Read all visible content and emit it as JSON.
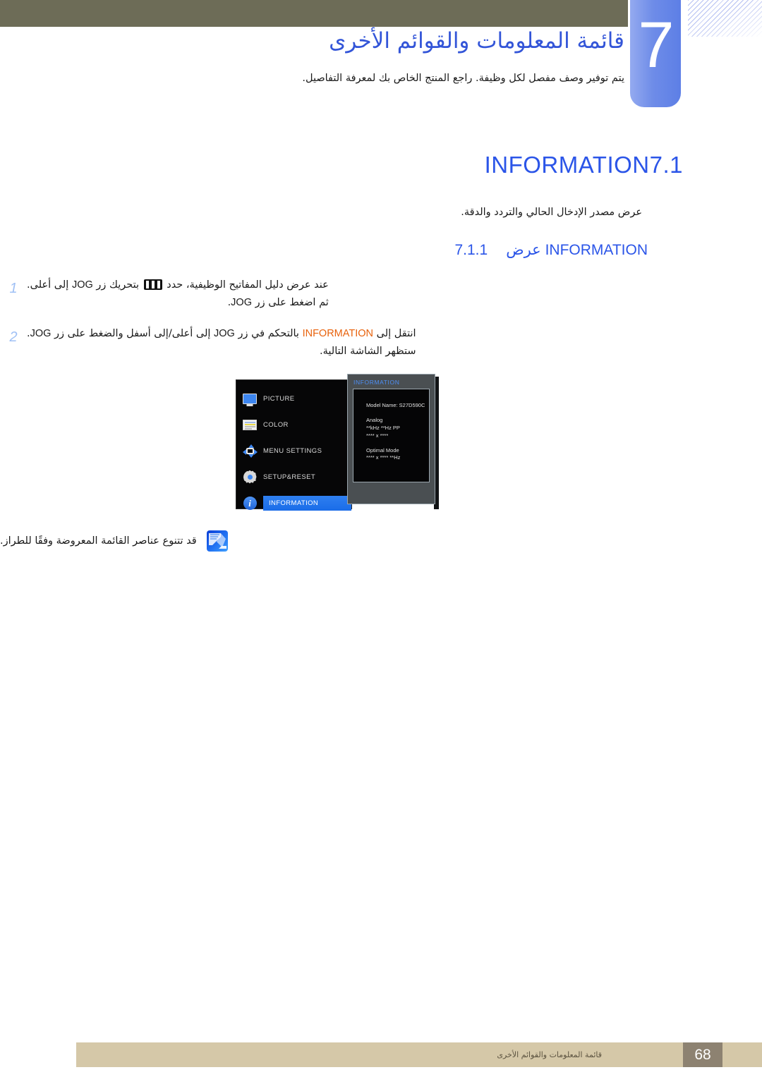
{
  "chapter": {
    "number": "7",
    "title": "قائمة المعلومات والقوائم الأخرى",
    "subtitle": "يتم توفير وصف مفصل لكل وظيفة. راجع المنتج الخاص بك لمعرفة التفاصيل."
  },
  "section": {
    "number": "7.1",
    "title": "INFORMATION",
    "description": "عرض مصدر الإدخال الحالي والتردد والدقة.",
    "sub_number": "7.1.1",
    "sub_title_ar": "عرض",
    "sub_title_en": "INFORMATION"
  },
  "steps": [
    {
      "number": "1",
      "text_before": "عند عرض دليل المفاتيح الوظيفية، حدد",
      "icon": "menu-bars-icon",
      "text_mid": "بتحريك زر",
      "key": "JOG",
      "text_after": "إلى أعلى.",
      "line2_before": "ثم اضغط على زر",
      "line2_key": "JOG",
      "line2_after": "."
    },
    {
      "number": "2",
      "text_before": "انتقل إلى",
      "highlight": "INFORMATION",
      "text_mid": "بالتحكم في زر",
      "key": "JOG",
      "text_after": "إلى أعلى/إلى أسفل والضغط على زر",
      "key2": "JOG",
      "text_end": ".",
      "line2": "ستظهر الشاشة التالية."
    }
  ],
  "osd": {
    "menu_items": [
      {
        "icon": "monitor-icon",
        "label": "PICTURE",
        "active": false
      },
      {
        "icon": "color-bars-icon",
        "label": "COLOR",
        "active": false
      },
      {
        "icon": "four-arrows-icon",
        "label": "MENU SETTINGS",
        "active": false
      },
      {
        "icon": "gear-icon",
        "label": "SETUP&RESET",
        "active": false
      },
      {
        "icon": "info-circle-icon",
        "label": "INFORMATION",
        "active": true
      }
    ],
    "panel_title": "INFORMATION",
    "info_lines": [
      "Model Name: S27D590C",
      "Analog",
      "**kHz **Hz PP",
      "**** x ****",
      "Optimal Mode",
      "**** x **** **Hz"
    ]
  },
  "note": {
    "icon": "note-pencil-icon",
    "text": "قد تتنوع عناصر القائمة المعروضة وفقًا للطراز."
  },
  "footer": {
    "text": "قائمة المعلومات والقوائم الأخرى",
    "page_number": "68"
  },
  "colors": {
    "top_bar": "#6d6c57",
    "accent_blue": "#2b55e8",
    "badge_blue": "#6e8ce8",
    "highlight_orange": "#e8620c",
    "step_number": "#9fc0f5",
    "footer_bar": "#d5c8a8",
    "page_number_box": "#8d8271",
    "osd_highlight": "#1a6ce8"
  }
}
